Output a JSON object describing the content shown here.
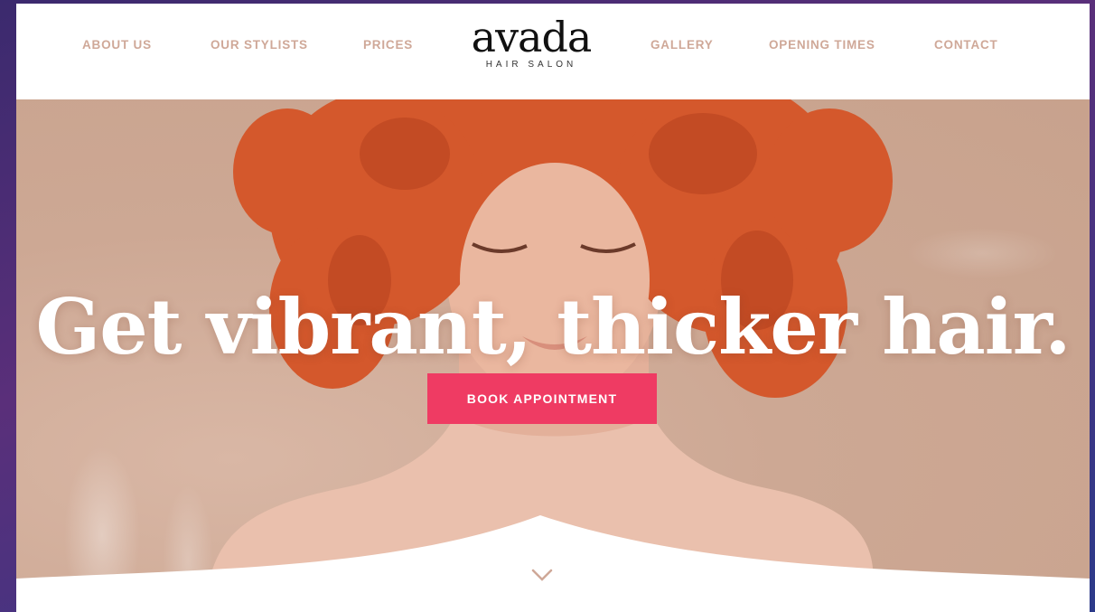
{
  "nav": {
    "left": [
      "ABOUT US",
      "OUR STYLISTS",
      "PRICES"
    ],
    "right": [
      "GALLERY",
      "OPENING TIMES",
      "CONTACT"
    ]
  },
  "logo": {
    "wordmark": "avada",
    "tagline": "HAIR SALON"
  },
  "hero": {
    "headline": "Get vibrant, thicker hair.",
    "cta_label": "BOOK APPOINTMENT",
    "scroll_icon": "chevron-down-icon"
  },
  "colors": {
    "accent": "#ef3b63",
    "nav_text": "#cfa898",
    "hero_bg": "#cda894",
    "hair": "#d4582c"
  }
}
